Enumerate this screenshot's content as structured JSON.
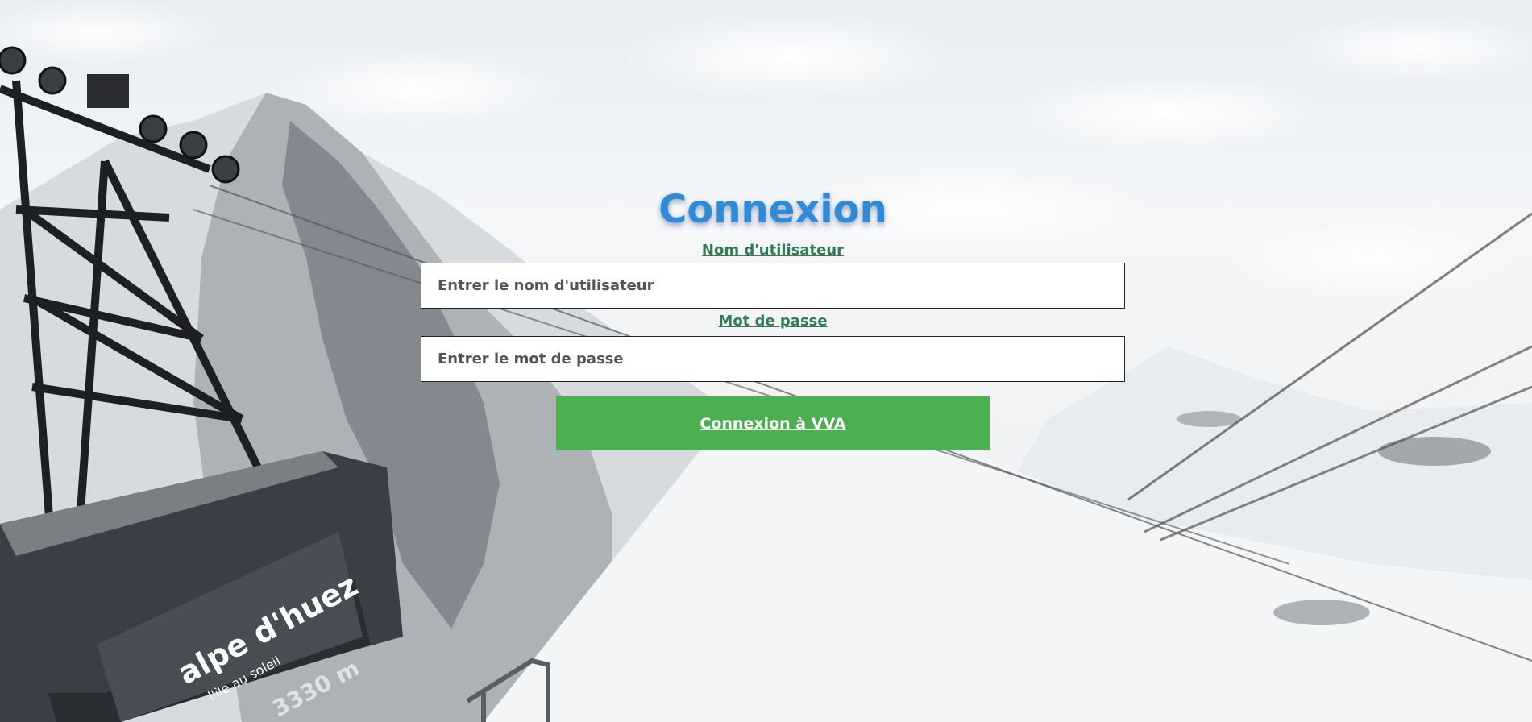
{
  "login": {
    "title": "Connexion",
    "username_label": "Nom d'utilisateur",
    "username_placeholder": "Entrer le nom d'utilisateur",
    "username_value": "",
    "password_label": "Mot de passe",
    "password_placeholder": "Entrer le mot de passe",
    "password_value": "",
    "submit_label": "Connexion à VVA"
  },
  "background": {
    "description_icon": "ski-resort-cable-car-photo",
    "cabin_sign_text": "alpe d'huez",
    "cabin_sign_subtext": "l'île au soleil",
    "cabin_altitude_text": "3330 m"
  },
  "colors": {
    "title": "#2f8ad8",
    "label": "#2f7d52",
    "button": "#4caf50"
  }
}
